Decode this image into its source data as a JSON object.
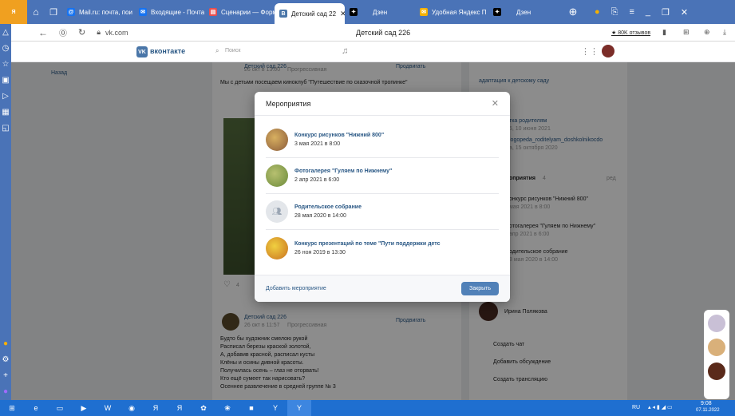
{
  "browser": {
    "tabs": [
      {
        "label": "Mail.ru: почта, пои",
        "icon": "mail-icon",
        "color": "#1673f1"
      },
      {
        "label": "Входящие - Почта",
        "icon": "inbox-icon",
        "color": "#1673f1"
      },
      {
        "label": "Сценарии — Форм",
        "icon": "forms-icon",
        "color": "#e84f4f"
      },
      {
        "label": "Детский сад 22",
        "icon": "vk-icon",
        "color": "#4a76a8"
      },
      {
        "label": "Дзен",
        "icon": "zen-icon",
        "color": "#000000"
      },
      {
        "label": "Удобная Яндекс П",
        "icon": "yandex-mail-icon",
        "color": "#f5b100"
      },
      {
        "label": "Дзен",
        "icon": "zen-icon",
        "color": "#000000"
      }
    ],
    "url": "vk.com",
    "page_title": "Детский сад 226",
    "reviews": "★ 80K отзывов"
  },
  "vk": {
    "logo": "вконтакте",
    "search_placeholder": "Поиск",
    "feed": {
      "post1_group": "Детский сад 226",
      "post1_time": "26 окт в 13:00",
      "post1_source": "Прогрессивная",
      "post1_text": "Мы с детьми посещаем кинoклуб \"Путешествие по сказочной тропинке\"",
      "post1_promote": "Продвигать",
      "post2_group": "Детский сад 226",
      "post2_time": "26 окт в 11:57",
      "post2_source": "Прогрессивная",
      "post2_promote": "Продвигать",
      "poem": [
        "Будто бы художник смелою рукой",
        "Расписал березы краской золотой,",
        "А, добавив красной, расписал кусты",
        "Клёны и осины дивной красоты.",
        "Получилась осень – глаз не оторвать!",
        "Кто ещё сумеет так нарисовать?",
        "Осеннее развлечение в средней группе № 3"
      ]
    },
    "right": {
      "link1": "адаптация к детскому саду",
      "doc1": "тка родителям",
      "doc1_date": "5, 10 июня 2021",
      "doc2": "logopeda_roditelyam_doshkolnikocdo",
      "doc2_date": "а, 15 октября 2020",
      "events_title": "оприятия",
      "events_count": "4",
      "events_more": "ред",
      "e1": "онкурс рисунков \"Нижний 800\"",
      "e1_date": "мая 2021 в 8:00",
      "e2": "отогалерея \"Гуляем по Нижнему\"",
      "e2_date": "апр 2021 в 6:00",
      "e3": "одительское собрание",
      "e3_date": "8 мая 2020 в 14:00",
      "contact": "Ирина Полякова",
      "act1": "Создать чат",
      "act2": "Добавить обсуждение",
      "act3": "Создать трансляцию"
    },
    "left_nav": "Назад",
    "likes": "4"
  },
  "modal": {
    "title": "Мероприятия",
    "events": [
      {
        "title": "Конкурс рисунков \"Нижний 800\"",
        "date": "3 мая 2021 в 8:00",
        "color": "#8a5a3a"
      },
      {
        "title": "Фотогалерея \"Гуляем по Нижнему\"",
        "date": "2 апр 2021 в 6:00",
        "color": "#6b8a3a"
      },
      {
        "title": "Родительское собрание",
        "date": "28 мая 2020 в 14:00",
        "color": "#e3e6ea"
      },
      {
        "title": "Конкурс презентаций по теме \"Пути поддержки детс",
        "date": "26 ноя 2019 в 13:30",
        "color": "#c9a020"
      }
    ],
    "add_label": "Добавить мероприятие",
    "close_label": "Закрыть"
  },
  "taskbar": {
    "lang": "RU",
    "time": "9:08",
    "date": "07.11.2022"
  }
}
